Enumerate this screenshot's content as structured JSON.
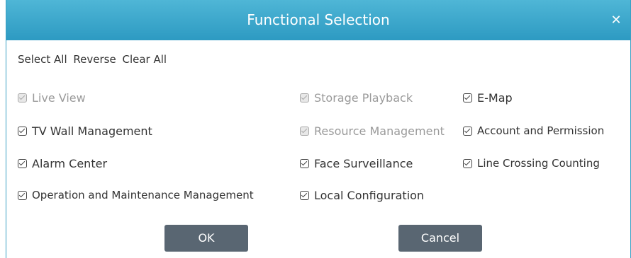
{
  "dialog": {
    "title": "Functional Selection",
    "close_glyph": "✕"
  },
  "toolbar": {
    "select_all": "Select All",
    "reverse": "Reverse",
    "clear_all": "Clear All"
  },
  "options": {
    "live_view": {
      "label": "Live View",
      "checked": true,
      "disabled": true
    },
    "storage_playback": {
      "label": "Storage Playback",
      "checked": true,
      "disabled": true
    },
    "e_map": {
      "label": "E-Map",
      "checked": true,
      "disabled": false
    },
    "tv_wall": {
      "label": "TV Wall Management",
      "checked": true,
      "disabled": false
    },
    "resource_management": {
      "label": "Resource Management",
      "checked": true,
      "disabled": true
    },
    "account_permission": {
      "label": "Account and Permission",
      "checked": true,
      "disabled": false
    },
    "alarm_center": {
      "label": "Alarm Center",
      "checked": true,
      "disabled": false
    },
    "face_surveillance": {
      "label": "Face Surveillance",
      "checked": true,
      "disabled": false
    },
    "line_crossing": {
      "label": "Line Crossing Counting",
      "checked": true,
      "disabled": false
    },
    "operation_maintenance": {
      "label": "Operation and Maintenance Management",
      "checked": true,
      "disabled": false
    },
    "local_configuration": {
      "label": "Local Configuration",
      "checked": true,
      "disabled": false
    }
  },
  "buttons": {
    "ok": "OK",
    "cancel": "Cancel"
  },
  "colors": {
    "title_bar": "#3aa6cc",
    "button": "#596672",
    "disabled_text": "#9a9a9a"
  }
}
